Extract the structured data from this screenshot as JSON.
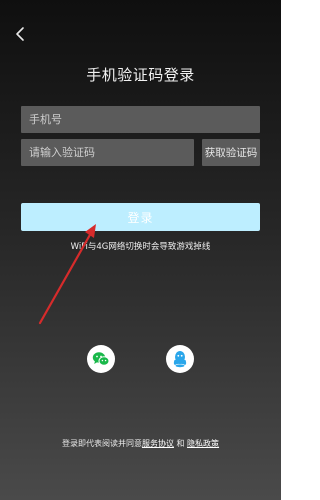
{
  "header": {
    "title": "手机验证码登录"
  },
  "form": {
    "phone_placeholder": "手机号",
    "code_placeholder": "请输入验证码",
    "get_code_label": "获取验证码",
    "login_label": "登录"
  },
  "notice": {
    "text": "WiFi与4G网络切换时会导致游戏掉线"
  },
  "footer": {
    "prefix": "登录即代表阅读并同意",
    "service_link": "服务协议",
    "separator": " 和 ",
    "privacy_link": "隐私政策"
  },
  "icons": {
    "back": "back-icon",
    "wechat": "wechat-icon",
    "qq": "qq-icon"
  },
  "colors": {
    "login_button": "#bdeeff",
    "input_bg": "#5b5b5b",
    "arrow": "#d62b2b",
    "wechat_green": "#19b84a",
    "qq_blue": "#2aa6ea"
  }
}
